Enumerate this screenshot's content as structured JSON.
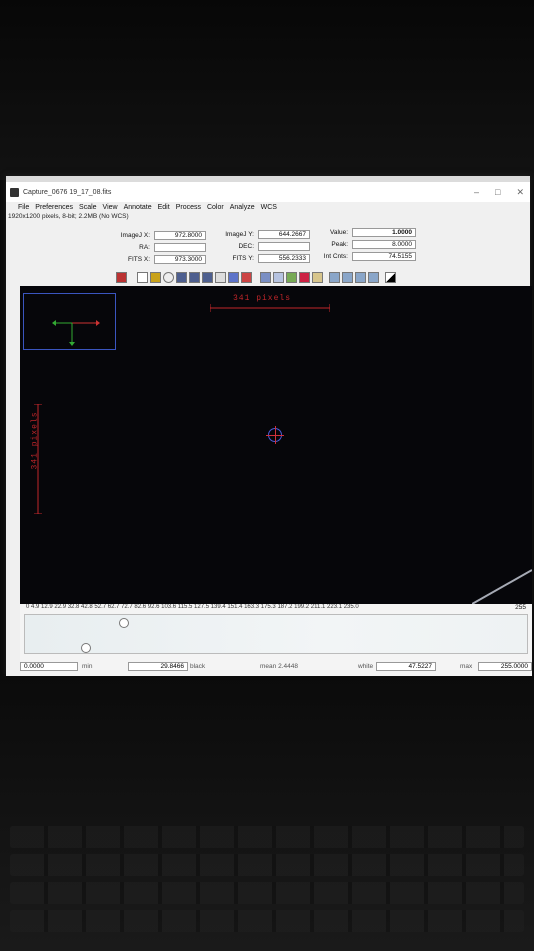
{
  "window": {
    "title": "Capture_0676 19_17_08.fits",
    "info": "1920x1200 pixels, 8-bit; 2.2MB (No WCS)"
  },
  "menu": [
    "File",
    "Preferences",
    "Scale",
    "View",
    "Annotate",
    "Edit",
    "Process",
    "Color",
    "Analyze",
    "WCS"
  ],
  "fields": {
    "imagej_x": {
      "label": "ImageJ X:",
      "value": "972.8000"
    },
    "imagej_y": {
      "label": "ImageJ Y:",
      "value": "644.2667"
    },
    "value": {
      "label": "Value:",
      "value": "1.0000"
    },
    "ra": {
      "label": "RA:",
      "value": ""
    },
    "dec": {
      "label": "DEC:",
      "value": ""
    },
    "peak": {
      "label": "Peak:",
      "value": "8.0000"
    },
    "fits_x": {
      "label": "FITS X:",
      "value": "973.3000"
    },
    "fits_y": {
      "label": "FITS Y:",
      "value": "556.2333"
    },
    "int_cnts": {
      "label": "Int Cnts:",
      "value": "74.5155"
    }
  },
  "canvas": {
    "ruler_h": "341 pixels",
    "ruler_v": "341 pixels"
  },
  "colorbar": {
    "ticks": "0   4.9  12.9  22.9  32.8  42.8  52.7  62.7  72.7  82.6  92.6  103.6  115.5  127.5  139.4  151.4  163.3  175.3  187.2  199.2  211.1  223.1  235.0",
    "max_tick": "255",
    "min_value": "0.0000",
    "min_label": "min",
    "black_value": "29.8466",
    "black_label": "black",
    "mean": "mean 2.4448",
    "white_label": "white",
    "white_value": "47.5227",
    "max_label": "max",
    "max_value": "255.0000"
  }
}
